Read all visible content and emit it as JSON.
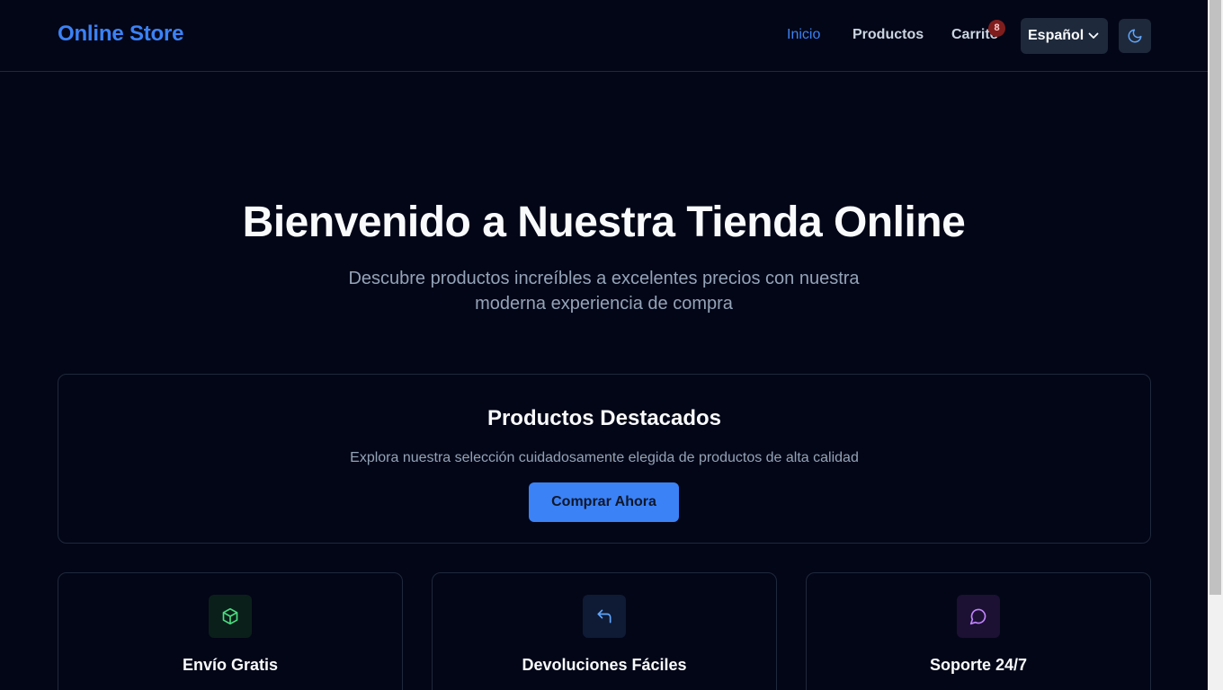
{
  "brand": {
    "name": "Online Store",
    "color": "#3b82f6"
  },
  "nav": {
    "items": [
      {
        "label": "Inicio",
        "active": true
      },
      {
        "label": "Productos",
        "active": false
      },
      {
        "label": "Carrito",
        "active": false
      }
    ],
    "cart_count": "8",
    "language": {
      "selected": "Español",
      "icon": "chevron-down-icon"
    },
    "theme_icon": "moon-icon"
  },
  "hero": {
    "title": "Bienvenido a Nuestra Tienda Online",
    "subtitle": "Descubre productos increíbles a excelentes precios con nuestra moderna experiencia de compra"
  },
  "featured": {
    "title": "Productos Destacados",
    "description": "Explora nuestra selección cuidadosamente elegida de productos de alta calidad",
    "button_label": "Comprar Ahora"
  },
  "features": [
    {
      "title": "Envío Gratis",
      "icon": "package-icon",
      "color": "#4ade80"
    },
    {
      "title": "Devoluciones Fáciles",
      "icon": "undo-arrow-icon",
      "color": "#60a5fa"
    },
    {
      "title": "Soporte 24/7",
      "icon": "chat-bubble-icon",
      "color": "#c084fc"
    }
  ]
}
